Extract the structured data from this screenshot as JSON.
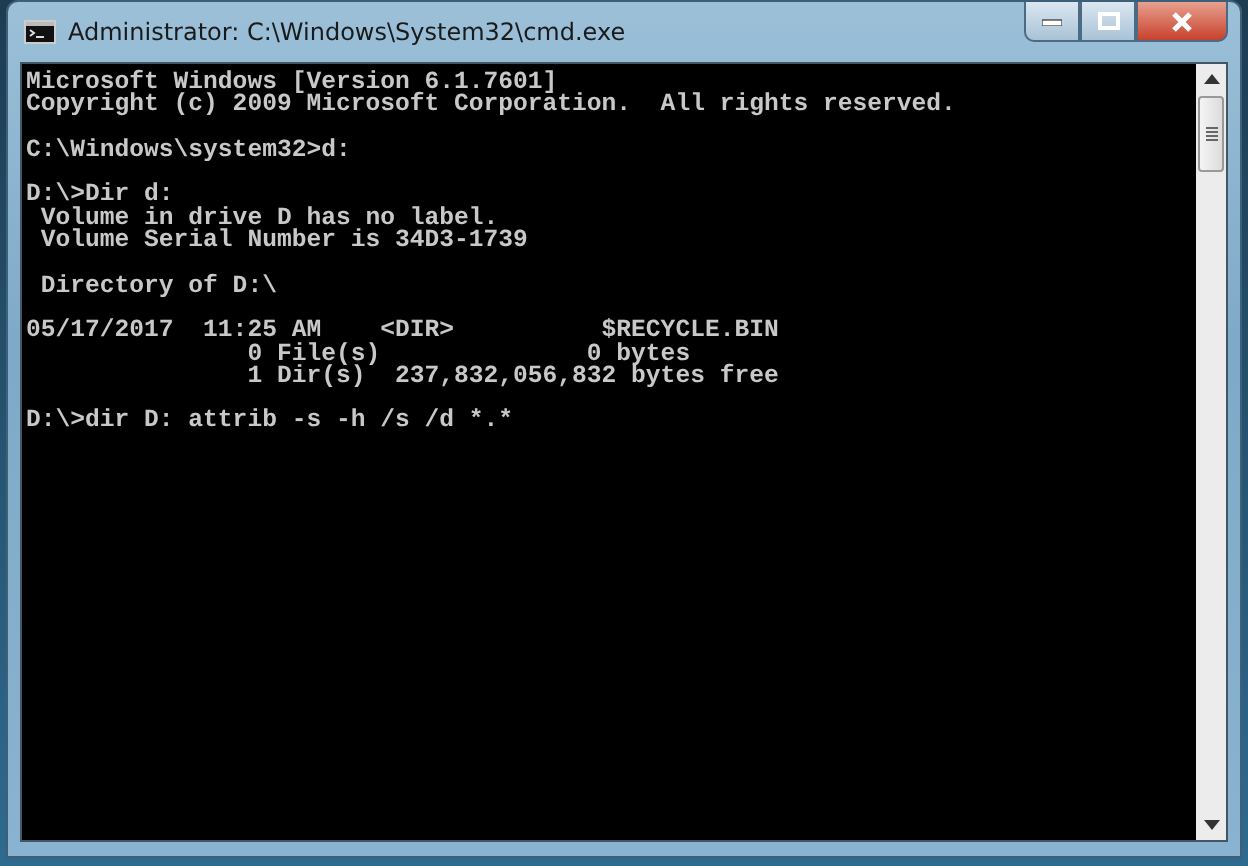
{
  "window": {
    "title": "Administrator: C:\\Windows\\System32\\cmd.exe"
  },
  "console": {
    "blocks": [
      [
        "Microsoft Windows [Version 6.1.7601]",
        "Copyright (c) 2009 Microsoft Corporation.  All rights reserved."
      ],
      [
        "C:\\Windows\\system32>d:"
      ],
      [
        "D:\\>Dir d:",
        " Volume in drive D has no label.",
        " Volume Serial Number is 34D3-1739"
      ],
      [
        " Directory of D:\\"
      ],
      [
        "05/17/2017  11:25 AM    <DIR>          $RECYCLE.BIN",
        "               0 File(s)              0 bytes",
        "               1 Dir(s)  237,832,056,832 bytes free"
      ],
      [
        "D:\\>dir D: attrib -s -h /s /d *.*"
      ]
    ]
  }
}
